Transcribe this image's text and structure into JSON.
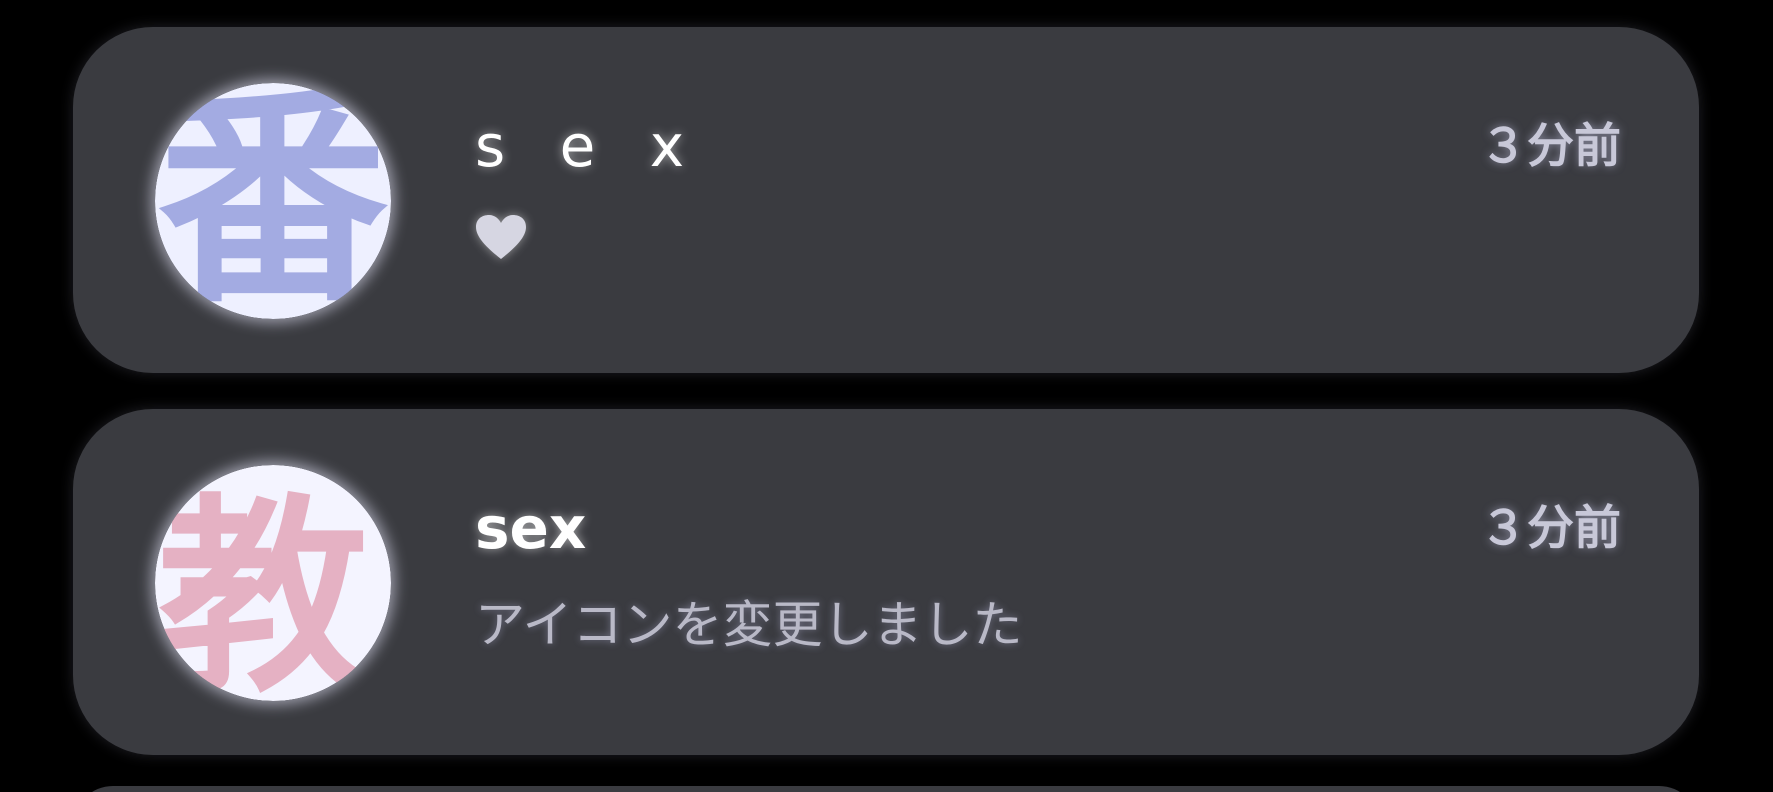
{
  "notifications": [
    {
      "username": "s e x",
      "timestamp": "３分前",
      "reaction_icon": "heart-icon",
      "avatar": {
        "glyph": "番",
        "glyph_color": "#8a94d8",
        "background": "#eef0ff"
      }
    },
    {
      "username": "sex",
      "timestamp": "３分前",
      "message": "アイコンを変更しました",
      "avatar": {
        "glyph": "教",
        "glyph_color": "#e2a0b4",
        "background": "#f4f4ff"
      }
    }
  ],
  "colors": {
    "page_background": "#000000",
    "card_background": "#3a3b40",
    "username_text": "#ffffff",
    "timestamp_text": "#c8c8d8",
    "message_text": "#b9b9c7",
    "heart_fill": "#d6d6e2"
  }
}
